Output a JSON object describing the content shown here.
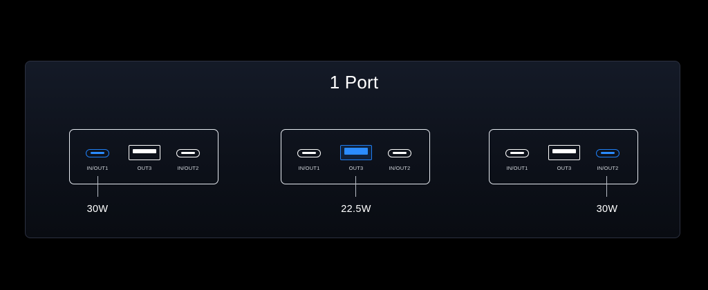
{
  "title": "1 Port",
  "configs": [
    {
      "ports": {
        "in_out1": "IN/OUT1",
        "out3": "OUT3",
        "in_out2": "IN/OUT2"
      },
      "active_port": "IN/OUT1",
      "power": "30W"
    },
    {
      "ports": {
        "in_out1": "IN/OUT1",
        "out3": "OUT3",
        "in_out2": "IN/OUT2"
      },
      "active_port": "OUT3",
      "power": "22.5W"
    },
    {
      "ports": {
        "in_out1": "IN/OUT1",
        "out3": "OUT3",
        "in_out2": "IN/OUT2"
      },
      "active_port": "IN/OUT2",
      "power": "30W"
    }
  ],
  "colors": {
    "background": "#000000",
    "panel": "#111622",
    "active_port": "#1f7ff5",
    "outline": "#e8ecf2",
    "text": "#ffffff"
  },
  "icons": [
    "usb-c-port-icon",
    "usb-a-port-icon"
  ]
}
